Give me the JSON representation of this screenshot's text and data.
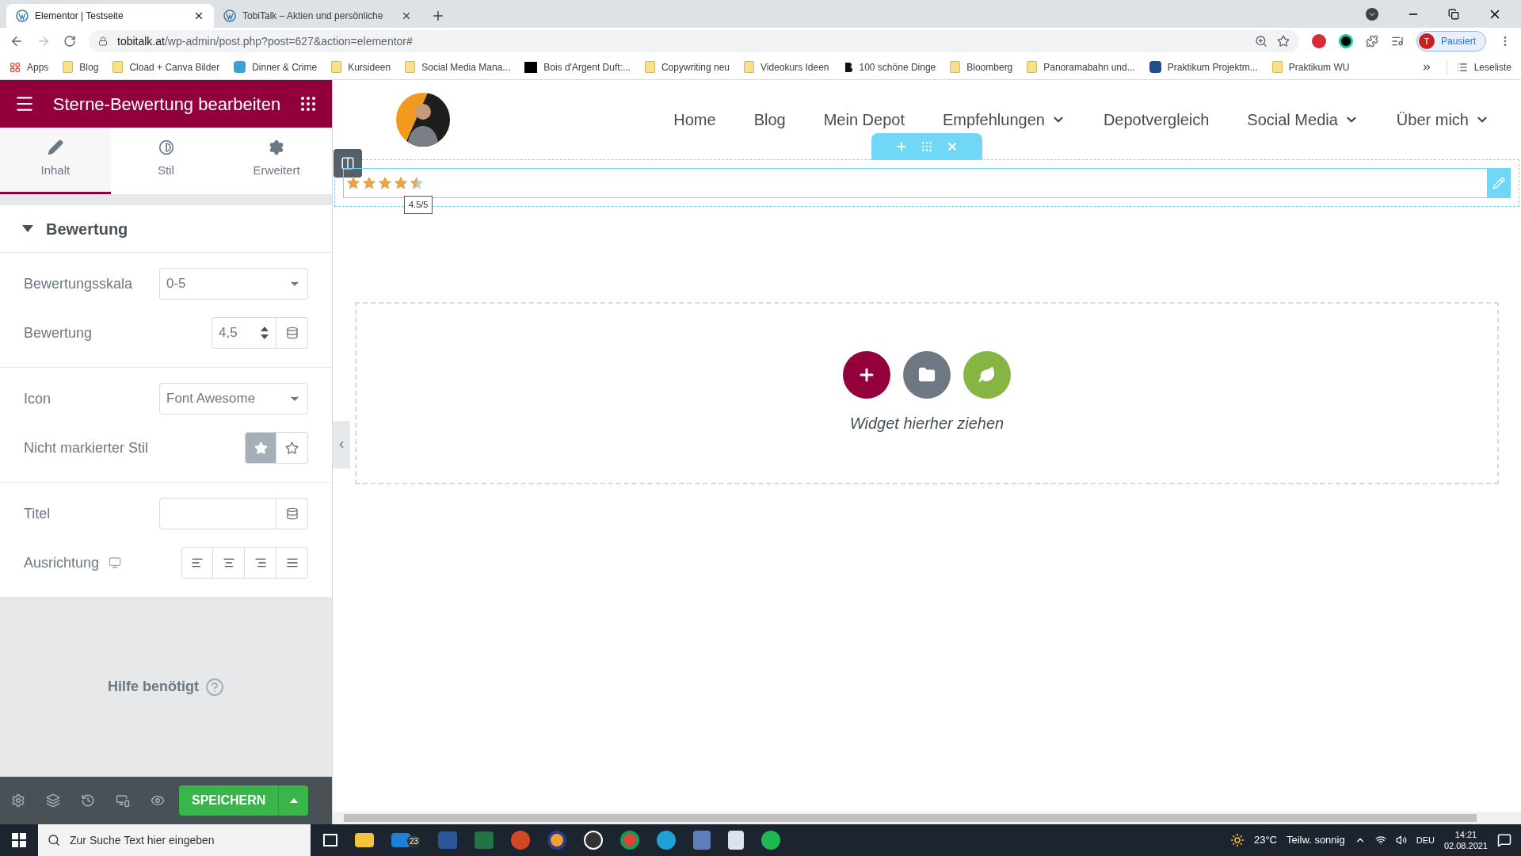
{
  "browser": {
    "tabs": [
      {
        "title": "Elementor | Testseite",
        "selected": true
      },
      {
        "title": "TobiTalk – Aktien und persönliche",
        "selected": false
      }
    ],
    "url_host": "tobitalk.at",
    "url_path": "/wp-admin/post.php?post=627&action=elementor#",
    "profile_initial": "T",
    "profile_label": "Pausiert",
    "bookmarks": [
      {
        "label": "Apps",
        "kind": "apps"
      },
      {
        "label": "Blog",
        "kind": "folder"
      },
      {
        "label": "Cload + Canva Bilder",
        "kind": "folder"
      },
      {
        "label": "Dinner & Crime",
        "kind": "jd"
      },
      {
        "label": "Kursideen",
        "kind": "folder"
      },
      {
        "label": "Social Media Mana...",
        "kind": "folder"
      },
      {
        "label": "Bois d'Argent Duft:...",
        "kind": "dark"
      },
      {
        "label": "Copywriting neu",
        "kind": "folder"
      },
      {
        "label": "Videokurs Ideen",
        "kind": "folder"
      },
      {
        "label": "100 schöne Dinge",
        "kind": "b"
      },
      {
        "label": "Bloomberg",
        "kind": "folder"
      },
      {
        "label": "Panoramabahn und...",
        "kind": "folder"
      },
      {
        "label": "Praktikum Projektm...",
        "kind": "j"
      },
      {
        "label": "Praktikum WU",
        "kind": "folder"
      }
    ],
    "reading_list": "Leseliste"
  },
  "panel": {
    "title": "Sterne-Bewertung bearbeiten",
    "tabs": [
      {
        "label": "Inhalt",
        "kind": "pencil",
        "selected": true
      },
      {
        "label": "Stil",
        "kind": "contrast",
        "selected": false
      },
      {
        "label": "Erweitert",
        "kind": "gear",
        "selected": false
      }
    ],
    "section": {
      "title": "Bewertung",
      "expanded": true
    },
    "scale": {
      "label": "Bewertungsskala",
      "value": "0-5"
    },
    "rating": {
      "label": "Bewertung",
      "value": "4,5"
    },
    "icon": {
      "label": "Icon",
      "value": "Font Awesome"
    },
    "unmarked_style": {
      "label": "Nicht markierter Stil",
      "options": [
        {
          "kind": "solid",
          "selected": true
        },
        {
          "kind": "outline",
          "selected": false
        }
      ]
    },
    "title_field": {
      "label": "Titel"
    },
    "alignment": {
      "label": "Ausrichtung",
      "options": [
        {
          "kind": "left",
          "selected": false
        },
        {
          "kind": "center",
          "selected": false
        },
        {
          "kind": "right",
          "selected": false
        },
        {
          "kind": "justify",
          "selected": false
        }
      ]
    },
    "help": "Hilfe benötigt",
    "save": "SPEICHERN"
  },
  "preview": {
    "nav": [
      {
        "label": "Home",
        "dropdown": false
      },
      {
        "label": "Blog",
        "dropdown": false
      },
      {
        "label": "Mein Depot",
        "dropdown": false
      },
      {
        "label": "Empfehlungen",
        "dropdown": true
      },
      {
        "label": "Depotvergleich",
        "dropdown": false
      },
      {
        "label": "Social Media",
        "dropdown": true
      },
      {
        "label": "Über mich",
        "dropdown": true
      }
    ],
    "stars": 4.5,
    "tooltip": "4.5/5",
    "drop_hint": "Widget hierher ziehen"
  },
  "taskbar": {
    "search_placeholder": "Zur Suche Text hier eingeben",
    "mail_badge": "23",
    "weather": "23°C",
    "weather_text": "Teilw. sonnig",
    "language": "DEU",
    "time": "14:21",
    "date": "02.08.2021"
  }
}
